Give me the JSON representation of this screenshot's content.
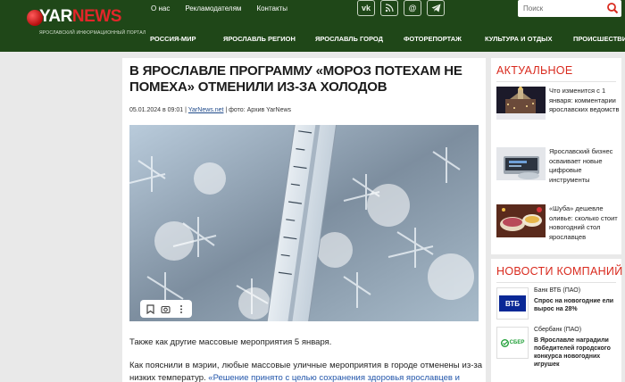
{
  "header": {
    "logo_text_a": "YAR",
    "logo_text_b": "NEWS",
    "logo_tagline": "ЯРОСЛАВСКИЙ ИНФОРМАЦИОННЫЙ ПОРТАЛ",
    "top_links": [
      "О нас",
      "Рекламодателям",
      "Контакты"
    ],
    "socials": [
      "vk-icon",
      "rss-icon",
      "email-icon",
      "telegram-icon"
    ],
    "search_placeholder": "Поиск",
    "nav": [
      "РОССИЯ-МИР",
      "ЯРОСЛАВЛЬ РЕГИОН",
      "ЯРОСЛАВЛЬ ГОРОД",
      "ФОТОРЕПОРТАЖ",
      "КУЛЬТУРА И ОТДЫХ",
      "ПРОИСШЕСТВИЯ"
    ],
    "brand_color": "#1f4718",
    "accent_color": "#e3262a"
  },
  "article": {
    "title": "В ЯРОСЛАВЛЕ ПРОГРАММУ «МОРОЗ ПОТЕХАМ НЕ ПОМЕХА» ОТМЕНИЛИ ИЗ-ЗА ХОЛОДОВ",
    "date": "05.01.2024 в 09:01",
    "source_link": "YarNews.net",
    "photo_credit": "фото: Архив YarNews",
    "photo_tools": [
      "bookmark-icon",
      "lens-icon",
      "more-icon"
    ],
    "para1": "Также как другие массовые мероприятия 5 января.",
    "para2_start": "Как пояснили в мэрии, любые массовые уличные мероприятия в городе отменены из-за низких температур. ",
    "para2_quote": "«Решение принято с целью сохранения здоровья ярославцев и"
  },
  "sidebar": {
    "actual_title": "АКТУАЛЬНОЕ",
    "news": [
      {
        "text": "Что изменится с 1 января: комментарии ярославских ведомств"
      },
      {
        "text": "Ярославский бизнес осваивает новые цифровые инструменты"
      },
      {
        "text": "«Шуба» дешевле оливье: сколько стоит новогодний стол ярославцев"
      }
    ],
    "companies_title": "НОВОСТИ КОМПАНИЙ",
    "companies": [
      {
        "name": "Банк ВТБ (ПАО)",
        "logo": "ВТБ",
        "text": "Спрос на новогодние ели вырос на 28%"
      },
      {
        "name": "Сбербанк (ПАО)",
        "logo": "СБЕР",
        "text": "В Ярославле наградили победителей городского конкурса новогодних игрушек"
      }
    ]
  }
}
